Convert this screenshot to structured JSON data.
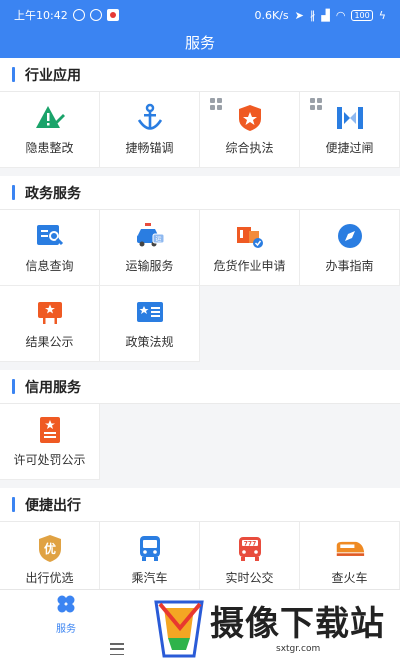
{
  "status": {
    "time": "上午10:42",
    "speed": "0.6K/s",
    "battery": "100"
  },
  "title": "服务",
  "sections": [
    {
      "title": "行业应用",
      "items": [
        {
          "label": "隐患整改",
          "icon": "hazard-edit-icon",
          "color": "#1aa36a",
          "badge": false
        },
        {
          "label": "捷畅锚调",
          "icon": "anchor-icon",
          "color": "#2a7de1",
          "badge": false
        },
        {
          "label": "综合执法",
          "icon": "police-badge-icon",
          "color": "#ef5a23",
          "badge": true
        },
        {
          "label": "便捷过闸",
          "icon": "lock-gate-icon",
          "color": "#2a7de1",
          "badge": true
        }
      ]
    },
    {
      "title": "政务服务",
      "items": [
        {
          "label": "信息查询",
          "icon": "info-search-icon",
          "color": "#2a7de1",
          "badge": false
        },
        {
          "label": "运输服务",
          "icon": "transport-car-icon",
          "color": "#2a7de1",
          "badge": false
        },
        {
          "label": "危货作业申请",
          "icon": "hazardous-cargo-icon",
          "color": "#ef5a23",
          "badge": false
        },
        {
          "label": "办事指南",
          "icon": "compass-icon",
          "color": "#2a7de1",
          "badge": false
        },
        {
          "label": "结果公示",
          "icon": "result-board-icon",
          "color": "#ef5a23",
          "badge": false
        },
        {
          "label": "政策法规",
          "icon": "policy-book-icon",
          "color": "#2a7de1",
          "badge": false
        }
      ]
    },
    {
      "title": "信用服务",
      "items": [
        {
          "label": "许可处罚公示",
          "icon": "permit-document-icon",
          "color": "#ef5a23",
          "badge": false
        }
      ]
    },
    {
      "title": "便捷出行",
      "items": [
        {
          "label": "出行优选",
          "icon": "you-badge-icon",
          "color": "#e0a243",
          "glyph": "优",
          "badge": false
        },
        {
          "label": "乘汽车",
          "icon": "bus-icon",
          "color": "#2a7de1",
          "badge": false
        },
        {
          "label": "实时公交",
          "icon": "realtime-bus-icon",
          "color": "#e84c3d",
          "badge": false
        },
        {
          "label": "查火车",
          "icon": "train-icon",
          "color": "#ef8a23",
          "badge": false
        }
      ]
    }
  ],
  "tabbar": {
    "label": "服务"
  },
  "watermark": {
    "text": "摄像下载站",
    "url": "sxtgr.com"
  }
}
